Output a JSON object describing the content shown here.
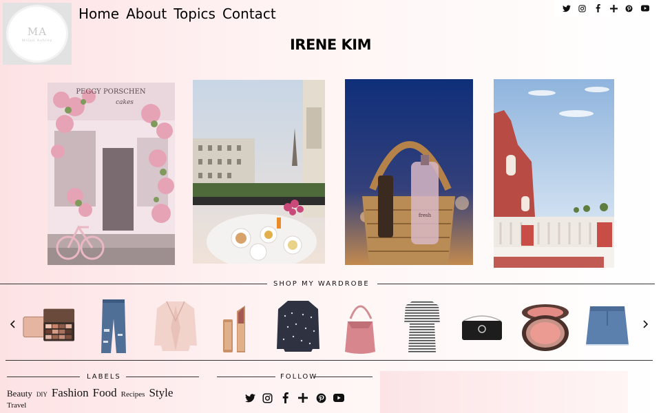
{
  "logo": {
    "initials": "MA",
    "subtitle": "Milan Ashley"
  },
  "nav": {
    "items": [
      "Home",
      "About",
      "Topics",
      "Contact"
    ]
  },
  "social_top": [
    "twitter-icon",
    "instagram-icon",
    "facebook-icon",
    "plus-icon",
    "pinterest-icon",
    "youtube-icon"
  ],
  "page_title": "IRENE KIM",
  "photos": [
    {
      "name": "cafe-flowers-photo",
      "sign": "PEGGY PORSCHEN",
      "sign2": "cakes"
    },
    {
      "name": "paris-breakfast-photo"
    },
    {
      "name": "picnic-basket-photo",
      "bottle": "fresh"
    },
    {
      "name": "positano-terrace-photo"
    }
  ],
  "wardrobe": {
    "title": "SHOP MY WARDROBE",
    "items": [
      "eyeshadow-palette",
      "ripped-jeans",
      "pink-blazer",
      "lipstick-duo",
      "dotted-shirt",
      "pink-bucket-bag",
      "striped-dress",
      "black-shoulder-bag",
      "blush-compact",
      "denim-skirt"
    ]
  },
  "labels": {
    "title": "LABELS",
    "items": [
      "Beauty",
      "DIY",
      "Fashion",
      "Food",
      "Recipes",
      "Style",
      "Travel"
    ]
  },
  "follow": {
    "title": "FOLLOW",
    "icons": [
      "twitter-icon",
      "instagram-icon",
      "facebook-icon",
      "plus-icon",
      "pinterest-icon",
      "youtube-icon"
    ]
  },
  "colors": {
    "accent": "#e8a6ad",
    "text": "#111111",
    "rule": "#333333"
  }
}
